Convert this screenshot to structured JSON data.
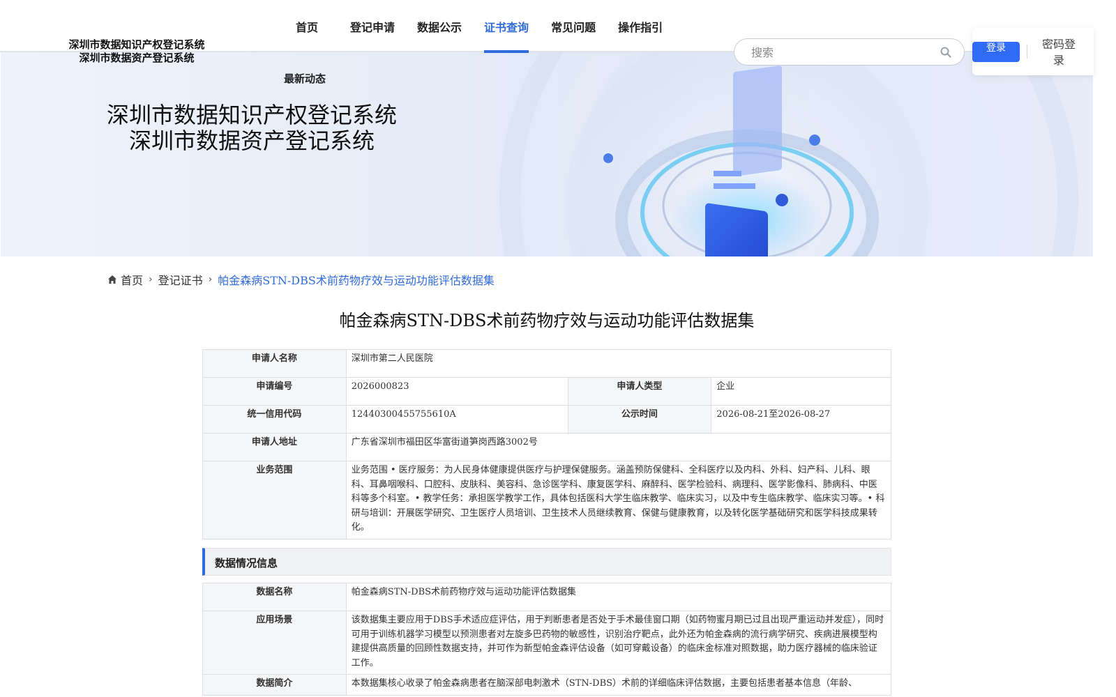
{
  "header": {
    "logo_line1": "深圳市数据知识产权登记系统",
    "logo_line2": "深圳市数据资产登记系统",
    "nav": [
      {
        "label": "首页",
        "active": false
      },
      {
        "label": "登记申请",
        "active": false
      },
      {
        "label": "数据公示",
        "active": false
      },
      {
        "label": "证书查询",
        "active": true
      },
      {
        "label": "常见问题",
        "active": false
      },
      {
        "label": "操作指引",
        "active": false
      }
    ],
    "search_placeholder": "搜索",
    "login_button": "登录",
    "password_login": "密码登录",
    "accent_color": "#2f6bd9"
  },
  "hero": {
    "subtitle": "最新动态",
    "title_line1": "深圳市数据知识产权登记系统",
    "title_line2": "深圳市数据资产登记系统"
  },
  "breadcrumb": {
    "home": "首页",
    "level1": "登记证书",
    "current": "帕金森病STN-DBS术前药物疗效与运动功能评估数据集"
  },
  "page_title": "帕金森病STN-DBS术前药物疗效与运动功能评估数据集",
  "applicant": {
    "name_label": "申请人名称",
    "name": "深圳市第二人民医院",
    "number_label": "申请编号",
    "number": "2026000823",
    "type_label": "申请人类型",
    "type": "企业",
    "credit_code_label": "统一信用代码",
    "credit_code": "12440300455755610A",
    "publish_time_label": "公示时间",
    "publish_time": "2026-08-21至2026-08-27",
    "address_label": "申请人地址",
    "address": "广东省深圳市福田区华富街道笋岗西路3002号",
    "scope_label": "业务范围",
    "scope": "业务范围 • 医疗服务：为人民身体健康提供医疗与护理保健服务。涵盖预防保健科、全科医疗以及内科、外科、妇产科、儿科、眼科、耳鼻咽喉科、口腔科、皮肤科、美容科、急诊医学科、康复医学科、麻醉科、医学检验科、病理科、医学影像科、肺病科、中医科等多个科室。• 教学任务：承担医学教学工作，具体包括医科大学生临床教学、临床实习，以及中专生临床教学、临床实习等。• 科研与培训：开展医学研究、卫生医疗人员培训、卫生技术人员继续教育、保健与健康教育，以及转化医学基础研究和医学科技成果转化。"
  },
  "data_section": {
    "title": "数据情况信息",
    "name_label": "数据名称",
    "name": "帕金森病STN-DBS术前药物疗效与运动功能评估数据集",
    "scenario_label": "应用场景",
    "scenario": "该数据集主要应用于DBS手术适应症评估，用于判断患者是否处于手术最佳窗口期（如药物蜜月期已过且出现严重运动并发症），同时可用于训练机器学习模型以预测患者对左旋多巴药物的敏感性，识别治疗靶点，此外还为帕金森病的流行病学研究、疾病进展模型构建提供高质量的回顾性数据支持，并可作为新型帕金森评估设备（如可穿戴设备）的临床金标准对照数据，助力医疗器械的临床验证工作。",
    "intro_label": "数据简介",
    "intro": "本数据集核心收录了帕金森病患者在脑深部电刺激术（STN-DBS）术前的详细临床评估数据，主要包括患者基本信息（年龄、"
  }
}
